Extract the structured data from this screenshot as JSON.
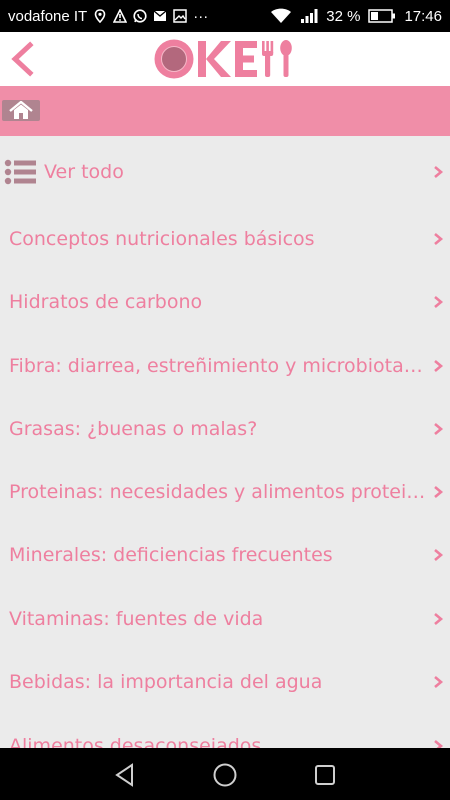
{
  "status_bar": {
    "carrier": "vodafone IT",
    "left_icons": [
      "location-icon",
      "alert-icon",
      "whatsapp-icon",
      "mail-icon",
      "image-icon",
      "more-icon"
    ],
    "more": "···",
    "battery_percent": "32 %",
    "time": "17:46"
  },
  "header": {
    "logo_text": "OKEI"
  },
  "list": {
    "items": [
      {
        "label": "Ver todo"
      },
      {
        "label": "Conceptos nutricionales básicos"
      },
      {
        "label": "Hidratos de carbono"
      },
      {
        "label": "Fibra: diarrea, estreñimiento y microbiota intestinal"
      },
      {
        "label": "Grasas: ¿buenas o malas?"
      },
      {
        "label": "Proteinas: necesidades y alimentos proteicos"
      },
      {
        "label": "Minerales: deficiencias frecuentes"
      },
      {
        "label": "Vitaminas: fuentes de vida"
      },
      {
        "label": "Bebidas: la importancia del agua"
      },
      {
        "label": "Alimentos desaconsejados"
      }
    ]
  },
  "colors": {
    "accent": "#ee7f9f",
    "home_bar": "#f08ea8",
    "background": "#ebebeb"
  }
}
